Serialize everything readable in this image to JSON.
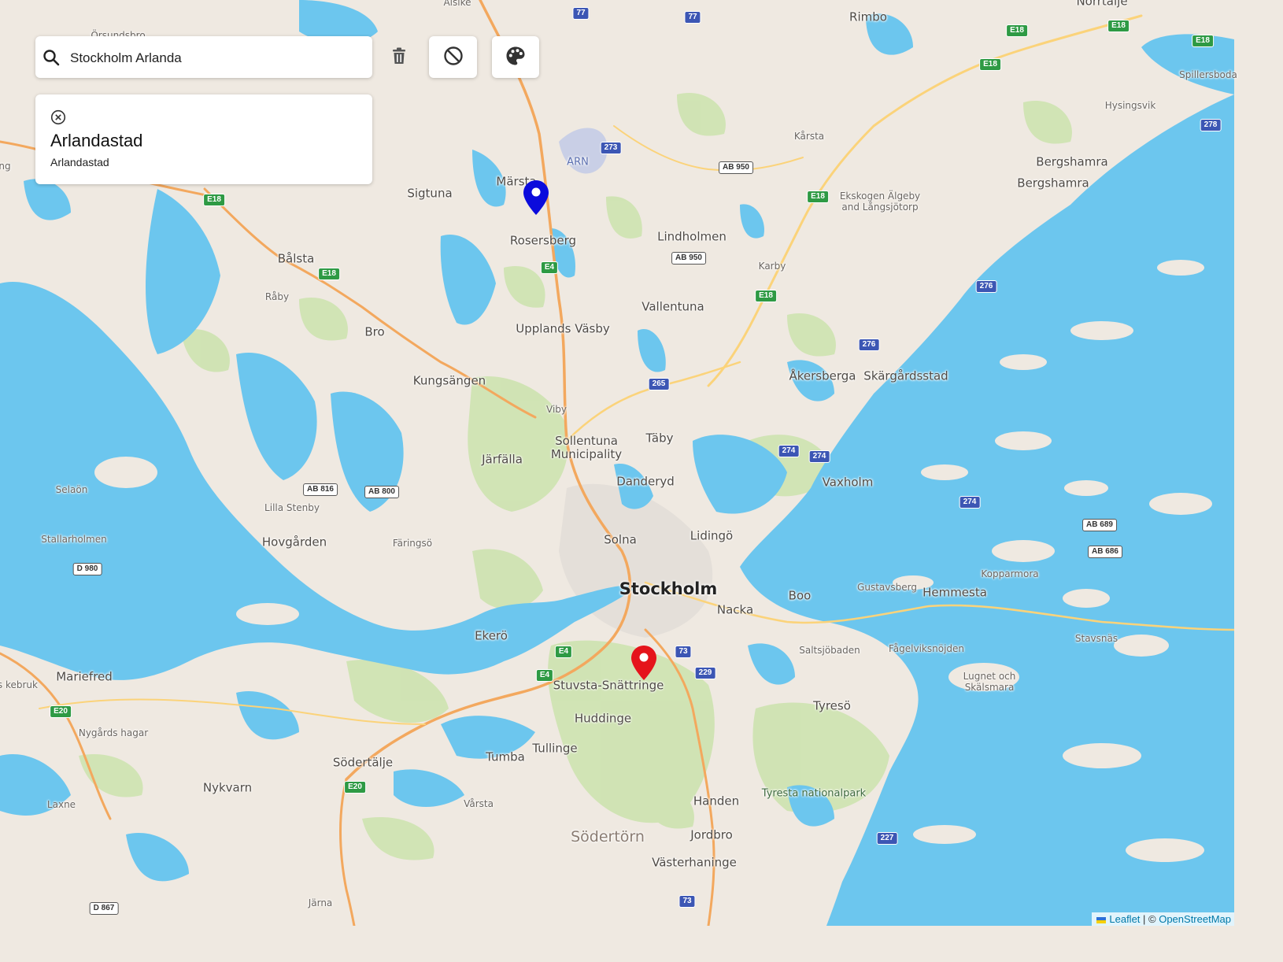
{
  "search": {
    "value": "Stockholm Arlanda",
    "placeholder": ""
  },
  "toolbar": {
    "trash_icon": "trash-icon",
    "clear_icon": "block-icon",
    "palette_icon": "palette-icon"
  },
  "result": {
    "title": "Arlandastad",
    "subtitle": "Arlandastad",
    "close_icon": "close-circle-icon"
  },
  "map": {
    "labels": [
      {
        "text": "Alsike",
        "cls": "small"
      },
      {
        "text": "Rimbo",
        "cls": "town"
      },
      {
        "text": "Norrtälje",
        "cls": "town"
      },
      {
        "text": "Örsundsbro",
        "cls": "small"
      },
      {
        "text": "Spillersboda",
        "cls": "small"
      },
      {
        "text": "Hysingsvik",
        "cls": "small"
      },
      {
        "text": "Kårsta",
        "cls": "small"
      },
      {
        "text": "Bergshamra",
        "cls": "town"
      },
      {
        "text": "Bergshamra",
        "cls": "town"
      },
      {
        "text": "Märsta",
        "cls": "town"
      },
      {
        "text": "Sigtuna",
        "cls": "town"
      },
      {
        "text": "Ekskogen Älgeby and Långsjötorp",
        "cls": "small"
      },
      {
        "text": "Rosersberg",
        "cls": "town"
      },
      {
        "text": "Lindholmen",
        "cls": "town"
      },
      {
        "text": "Bålsta",
        "cls": "town"
      },
      {
        "text": "Karby",
        "cls": "small"
      },
      {
        "text": "Råby",
        "cls": "small"
      },
      {
        "text": "Vallentuna",
        "cls": "town"
      },
      {
        "text": "Bro",
        "cls": "town"
      },
      {
        "text": "Upplands Väsby",
        "cls": "town"
      },
      {
        "text": "Åkersberga",
        "cls": "town"
      },
      {
        "text": "Skärgårdsstad",
        "cls": "town"
      },
      {
        "text": "Kungsängen",
        "cls": "town"
      },
      {
        "text": "Viby",
        "cls": "small"
      },
      {
        "text": "Sollentuna Municipality",
        "cls": "town"
      },
      {
        "text": "Täby",
        "cls": "town"
      },
      {
        "text": "Järfälla",
        "cls": "town"
      },
      {
        "text": "Danderyd",
        "cls": "town"
      },
      {
        "text": "Vaxholm",
        "cls": "town"
      },
      {
        "text": "Selaön",
        "cls": "small"
      },
      {
        "text": "Lilla Stenby",
        "cls": "small"
      },
      {
        "text": "Stallarholmen",
        "cls": "small"
      },
      {
        "text": "Hovgården",
        "cls": "town"
      },
      {
        "text": "Färingsö",
        "cls": "small"
      },
      {
        "text": "Solna",
        "cls": "town"
      },
      {
        "text": "Lidingö",
        "cls": "town"
      },
      {
        "text": "Stockholm",
        "cls": "big"
      },
      {
        "text": "Nacka",
        "cls": "town"
      },
      {
        "text": "Boo",
        "cls": "town"
      },
      {
        "text": "Gustavsberg",
        "cls": "small"
      },
      {
        "text": "Hemmesta",
        "cls": "town"
      },
      {
        "text": "Kopparmora",
        "cls": "small"
      },
      {
        "text": "Ekerö",
        "cls": "town"
      },
      {
        "text": "Stavsnäs",
        "cls": "small"
      },
      {
        "text": "Saltsjöbaden",
        "cls": "small"
      },
      {
        "text": "Fågelviksnöjden",
        "cls": "small"
      },
      {
        "text": "Mariefred",
        "cls": "town"
      },
      {
        "text": "Stuvsta-Snättringe",
        "cls": "town"
      },
      {
        "text": "Lugnet och Skälsmara",
        "cls": "small"
      },
      {
        "text": "Tyresö",
        "cls": "town"
      },
      {
        "text": "Huddinge",
        "cls": "town"
      },
      {
        "text": "Nygårds hagar",
        "cls": "small"
      },
      {
        "text": "Tullinge",
        "cls": "town"
      },
      {
        "text": "Tumba",
        "cls": "town"
      },
      {
        "text": "Södertälje",
        "cls": "town"
      },
      {
        "text": "Nykvarn",
        "cls": "town"
      },
      {
        "text": "Tyresta nationalpark",
        "cls": "park"
      },
      {
        "text": "Laxne",
        "cls": "small"
      },
      {
        "text": "Vårsta",
        "cls": "small"
      },
      {
        "text": "Handen",
        "cls": "town"
      },
      {
        "text": "Södertörn",
        "cls": "region"
      },
      {
        "text": "Jordbro",
        "cls": "town"
      },
      {
        "text": "Västerhaninge",
        "cls": "town"
      },
      {
        "text": "Järna",
        "cls": "small"
      },
      {
        "text": "ARN",
        "cls": "airport"
      },
      {
        "text": "ng",
        "cls": "small"
      },
      {
        "text": "kers kebruk",
        "cls": "small"
      }
    ],
    "shields": [
      {
        "text": "77",
        "cls": "n"
      },
      {
        "text": "77",
        "cls": "n"
      },
      {
        "text": "E18",
        "cls": "e"
      },
      {
        "text": "E18",
        "cls": "e"
      },
      {
        "text": "E18",
        "cls": "e"
      },
      {
        "text": "E18",
        "cls": "e"
      },
      {
        "text": "273",
        "cls": "n"
      },
      {
        "text": "AB 950",
        "cls": "w"
      },
      {
        "text": "278",
        "cls": "n"
      },
      {
        "text": "E18",
        "cls": "e"
      },
      {
        "text": "E18",
        "cls": "e"
      },
      {
        "text": "AB 950",
        "cls": "w"
      },
      {
        "text": "E4",
        "cls": "e"
      },
      {
        "text": "E18",
        "cls": "e"
      },
      {
        "text": "276",
        "cls": "n"
      },
      {
        "text": "E18",
        "cls": "e"
      },
      {
        "text": "276",
        "cls": "n"
      },
      {
        "text": "265",
        "cls": "n"
      },
      {
        "text": "274",
        "cls": "n"
      },
      {
        "text": "274",
        "cls": "n"
      },
      {
        "text": "AB 816",
        "cls": "w"
      },
      {
        "text": "AB 800",
        "cls": "w"
      },
      {
        "text": "274",
        "cls": "n"
      },
      {
        "text": "AB 689",
        "cls": "w"
      },
      {
        "text": "AB 686",
        "cls": "w"
      },
      {
        "text": "D 980",
        "cls": "w"
      },
      {
        "text": "E4",
        "cls": "e"
      },
      {
        "text": "73",
        "cls": "n"
      },
      {
        "text": "E4",
        "cls": "e"
      },
      {
        "text": "229",
        "cls": "n"
      },
      {
        "text": "E20",
        "cls": "e"
      },
      {
        "text": "E20",
        "cls": "e"
      },
      {
        "text": "227",
        "cls": "n"
      },
      {
        "text": "73",
        "cls": "n"
      },
      {
        "text": "D 867",
        "cls": "w"
      }
    ],
    "markers": [
      {
        "name": "start-marker-pin-icon",
        "color": "#0b0bdc"
      },
      {
        "name": "destination-marker-pin-icon",
        "color": "#e5141b"
      }
    ],
    "colors": {
      "water": "#6cc6ee",
      "land": "#efe9e1",
      "forest": "#cde3b0",
      "motorway": "#f3a85e",
      "road": "#fbd37a"
    }
  },
  "attribution": {
    "leaflet": "Leaflet",
    "sep": " | © ",
    "osm": "OpenStreetMap"
  }
}
